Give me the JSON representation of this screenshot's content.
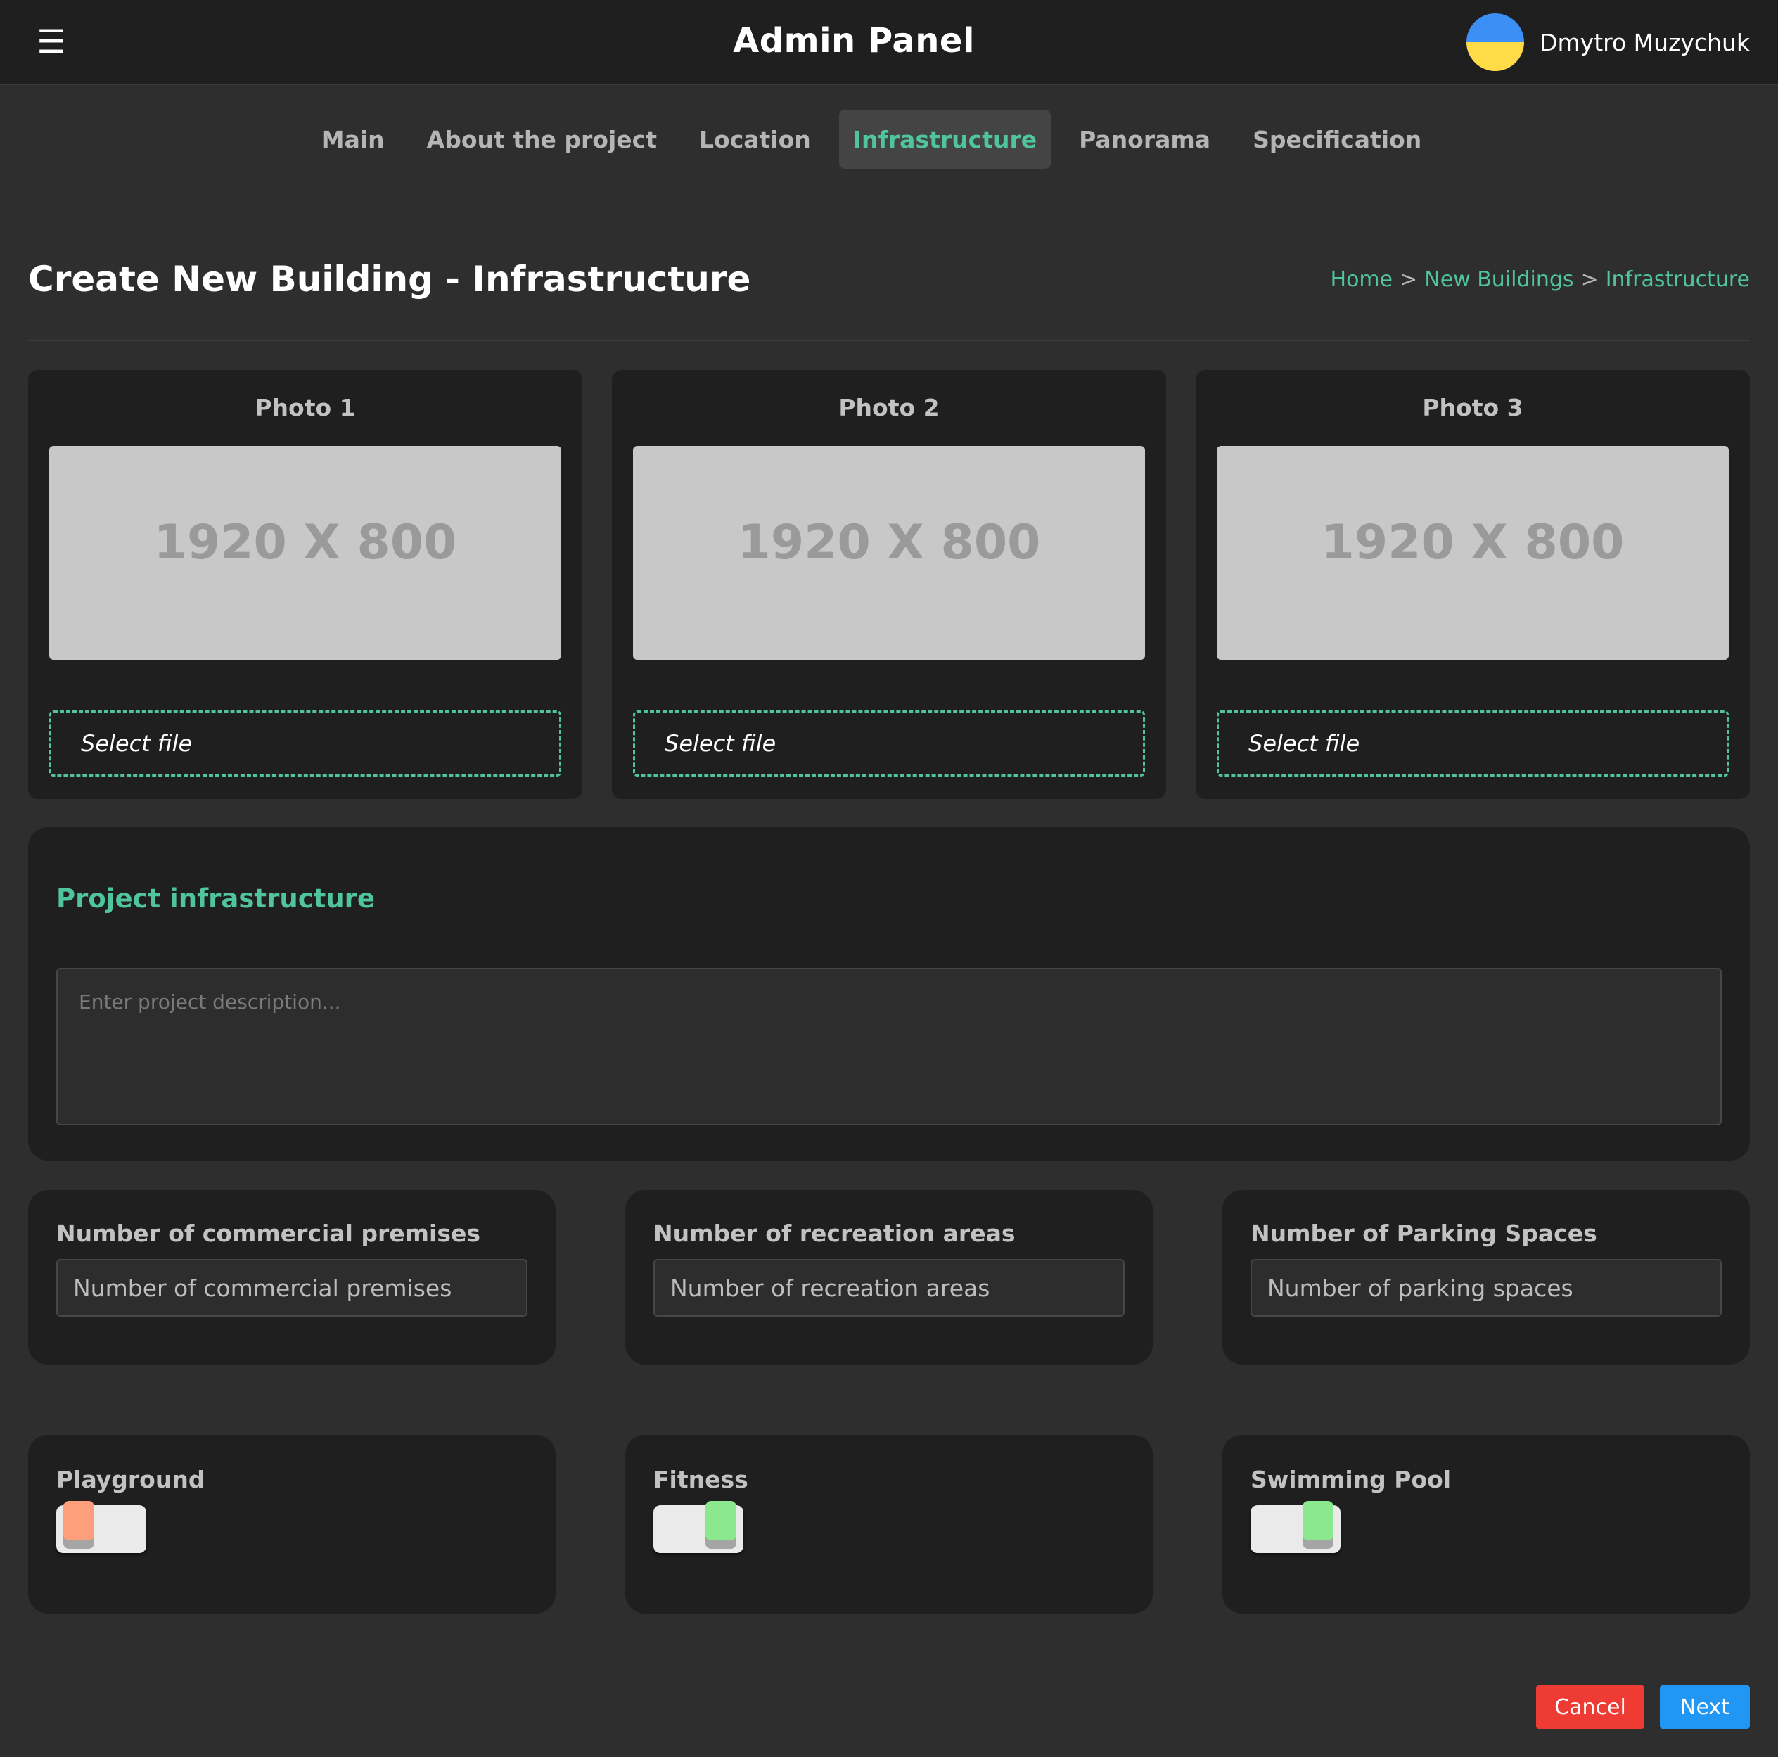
{
  "header": {
    "menu_icon": "hamburger-icon",
    "title": "Admin Panel",
    "user_name": "Dmytro Muzychuk",
    "avatar_colors": [
      "#3c8ff5",
      "#ffdb47"
    ]
  },
  "tabs": [
    {
      "label": "Main",
      "active": false
    },
    {
      "label": "About the project",
      "active": false
    },
    {
      "label": "Location",
      "active": false
    },
    {
      "label": "Infrastructure",
      "active": true
    },
    {
      "label": "Panorama",
      "active": false
    },
    {
      "label": "Specification",
      "active": false
    }
  ],
  "page": {
    "title": "Create New Building - Infrastructure",
    "breadcrumb": [
      "Home",
      ">",
      "New Buildings",
      ">",
      "Infrastructure"
    ]
  },
  "photos": [
    {
      "title": "Photo 1",
      "placeholder": "1920 X 800",
      "select_label": "Select file"
    },
    {
      "title": "Photo 2",
      "placeholder": "1920 X 800",
      "select_label": "Select file"
    },
    {
      "title": "Photo 3",
      "placeholder": "1920 X 800",
      "select_label": "Select file"
    }
  ],
  "infrastructure": {
    "title": "Project infrastructure",
    "description_placeholder": "Enter project description..."
  },
  "counts": [
    {
      "label": "Number of commercial premises",
      "placeholder": "Number of commercial premises"
    },
    {
      "label": "Number of recreation areas",
      "placeholder": "Number of recreation areas"
    },
    {
      "label": "Number of Parking Spaces",
      "placeholder": "Number of parking spaces"
    }
  ],
  "toggles": [
    {
      "label": "Playground",
      "on": false
    },
    {
      "label": "Fitness",
      "on": true
    },
    {
      "label": "Swimming Pool",
      "on": true
    }
  ],
  "actions": {
    "cancel_label": "Cancel",
    "next_label": "Next"
  },
  "colors": {
    "accent": "#4fc49f",
    "cancel": "#ee3b33",
    "next": "#2196f3",
    "toggle_off": "#ff9e7a",
    "toggle_on": "#8ce88c"
  }
}
